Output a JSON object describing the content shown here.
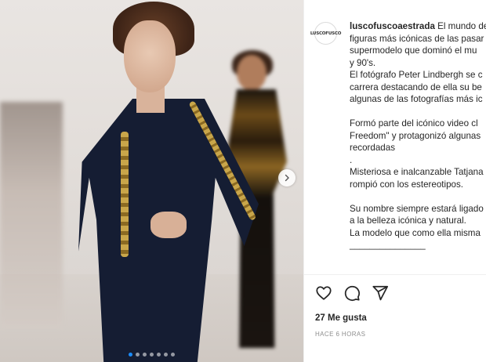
{
  "post": {
    "username": "luscofuscoaestrada",
    "avatar_text": "LUSCOFUSCO",
    "caption_lines": [
      "El mundo de",
      "figuras más icónicas de las pasar",
      "supermodelo que dominó el mu",
      "y 90's.",
      "El fotógrafo Peter Lindbergh se c",
      "carrera destacando de ella su be",
      "algunas de las fotografías más ic",
      "",
      "Formó parte del icónico video cl",
      "Freedom\" y protagonizó algunas",
      "recordadas",
      ".",
      "Misteriosa e inalcanzable Tatjana",
      "rompió con los estereotipos.",
      "",
      "Su nombre siempre estará ligado",
      "a la belleza icónica y natural.",
      "La modelo que como ella misma",
      "_______________",
      ""
    ],
    "likes": "27 Me gusta",
    "time": "HACE 6 HORAS"
  },
  "carousel": {
    "dot_count": 7,
    "active_index": 0
  },
  "icons": {
    "like": "heart-icon",
    "comment": "comment-icon",
    "share": "share-icon",
    "next": "chevron-right-icon"
  },
  "colors": {
    "active_dot": "#1a8cff",
    "text": "#262626",
    "muted": "#8e8e8e"
  }
}
